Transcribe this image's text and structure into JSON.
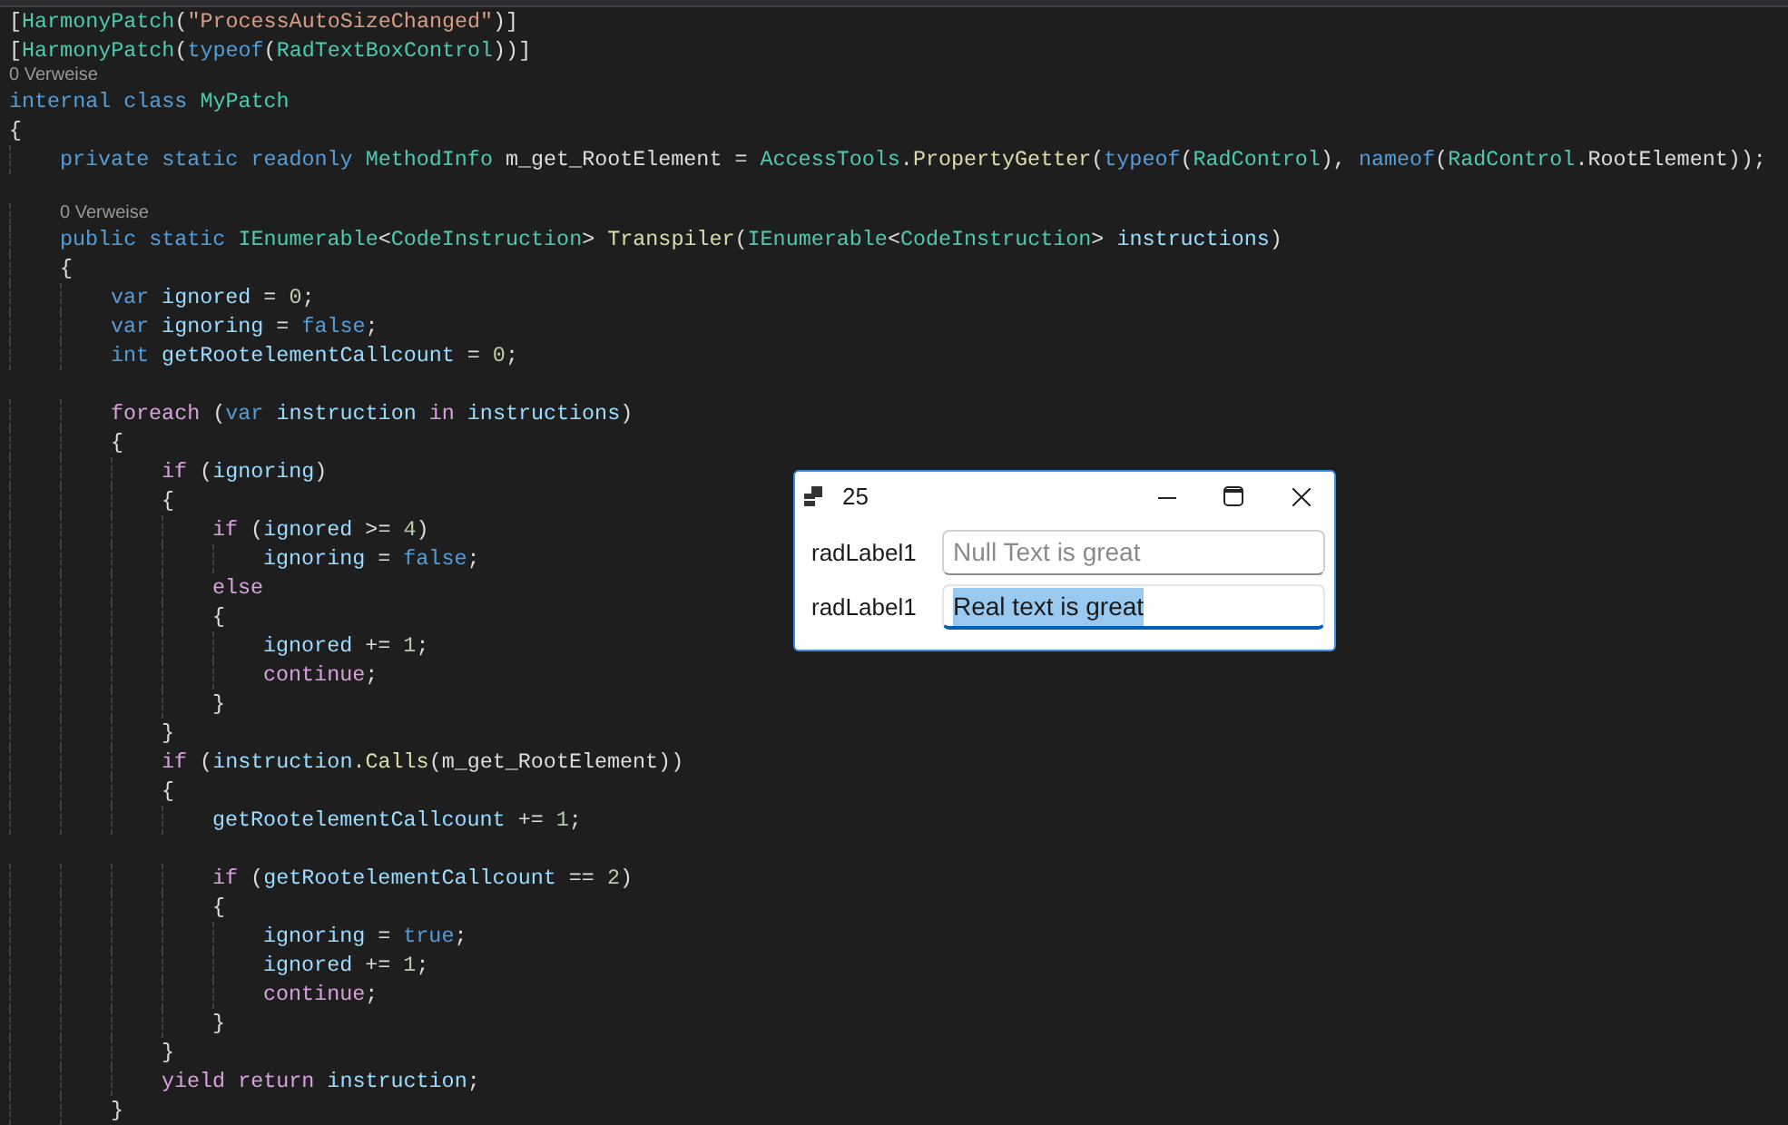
{
  "code_lines": [
    {
      "kind": "code",
      "tokens": [
        {
          "kind": "plain",
          "text": "["
        },
        {
          "kind": "type",
          "text": "HarmonyPatch"
        },
        {
          "kind": "plain",
          "text": "("
        },
        {
          "kind": "string",
          "text": "\"ProcessAutoSizeChanged\""
        },
        {
          "kind": "plain",
          "text": ")]"
        }
      ]
    },
    {
      "kind": "code",
      "tokens": [
        {
          "kind": "plain",
          "text": "["
        },
        {
          "kind": "type",
          "text": "HarmonyPatch"
        },
        {
          "kind": "plain",
          "text": "("
        },
        {
          "kind": "keyword",
          "text": "typeof"
        },
        {
          "kind": "plain",
          "text": "("
        },
        {
          "kind": "type",
          "text": "RadTextBoxControl"
        },
        {
          "kind": "plain",
          "text": "))]"
        }
      ]
    },
    {
      "kind": "lens",
      "text": "0 Verweise"
    },
    {
      "kind": "code",
      "tokens": [
        {
          "kind": "keyword",
          "text": "internal class "
        },
        {
          "kind": "type",
          "text": "MyPatch"
        }
      ]
    },
    {
      "kind": "code",
      "tokens": [
        {
          "kind": "plain",
          "text": "{"
        }
      ]
    },
    {
      "kind": "code",
      "tokens": [
        {
          "kind": "keyword",
          "text": "    private static readonly "
        },
        {
          "kind": "type",
          "text": "MethodInfo"
        },
        {
          "kind": "plain",
          "text": " m_get_RootElement = "
        },
        {
          "kind": "type",
          "text": "AccessTools"
        },
        {
          "kind": "plain",
          "text": "."
        },
        {
          "kind": "method",
          "text": "PropertyGetter"
        },
        {
          "kind": "plain",
          "text": "("
        },
        {
          "kind": "keyword",
          "text": "typeof"
        },
        {
          "kind": "plain",
          "text": "("
        },
        {
          "kind": "type",
          "text": "RadControl"
        },
        {
          "kind": "plain",
          "text": "), "
        },
        {
          "kind": "keyword",
          "text": "nameof"
        },
        {
          "kind": "plain",
          "text": "("
        },
        {
          "kind": "type",
          "text": "RadControl"
        },
        {
          "kind": "plain",
          "text": ".RootElement));"
        }
      ]
    },
    {
      "kind": "blank"
    },
    {
      "kind": "lens",
      "text": "    0 Verweise"
    },
    {
      "kind": "code",
      "tokens": [
        {
          "kind": "keyword",
          "text": "    public static "
        },
        {
          "kind": "type",
          "text": "IEnumerable"
        },
        {
          "kind": "plain",
          "text": "<"
        },
        {
          "kind": "type",
          "text": "CodeInstruction"
        },
        {
          "kind": "plain",
          "text": "> "
        },
        {
          "kind": "method",
          "text": "Transpiler"
        },
        {
          "kind": "plain",
          "text": "("
        },
        {
          "kind": "type",
          "text": "IEnumerable"
        },
        {
          "kind": "plain",
          "text": "<"
        },
        {
          "kind": "type",
          "text": "CodeInstruction"
        },
        {
          "kind": "plain",
          "text": "> "
        },
        {
          "kind": "ident",
          "text": "instructions"
        },
        {
          "kind": "plain",
          "text": ")"
        }
      ]
    },
    {
      "kind": "code",
      "tokens": [
        {
          "kind": "plain",
          "text": "    {"
        }
      ]
    },
    {
      "kind": "code",
      "tokens": [
        {
          "kind": "keyword",
          "text": "        var"
        },
        {
          "kind": "ident",
          "text": " ignored"
        },
        {
          "kind": "plain",
          "text": " = "
        },
        {
          "kind": "number",
          "text": "0"
        },
        {
          "kind": "plain",
          "text": ";"
        }
      ]
    },
    {
      "kind": "code",
      "tokens": [
        {
          "kind": "keyword",
          "text": "        var"
        },
        {
          "kind": "ident",
          "text": " ignoring"
        },
        {
          "kind": "plain",
          "text": " = "
        },
        {
          "kind": "keyword",
          "text": "false"
        },
        {
          "kind": "plain",
          "text": ";"
        }
      ]
    },
    {
      "kind": "code",
      "tokens": [
        {
          "kind": "keyword",
          "text": "        int"
        },
        {
          "kind": "ident",
          "text": " getRootelementCallcount"
        },
        {
          "kind": "plain",
          "text": " = "
        },
        {
          "kind": "number",
          "text": "0"
        },
        {
          "kind": "plain",
          "text": ";"
        }
      ]
    },
    {
      "kind": "blank"
    },
    {
      "kind": "code",
      "tokens": [
        {
          "kind": "control",
          "text": "        foreach"
        },
        {
          "kind": "plain",
          "text": " ("
        },
        {
          "kind": "keyword",
          "text": "var"
        },
        {
          "kind": "ident",
          "text": " instruction"
        },
        {
          "kind": "control",
          "text": " in"
        },
        {
          "kind": "ident",
          "text": " instructions"
        },
        {
          "kind": "plain",
          "text": ")"
        }
      ]
    },
    {
      "kind": "code",
      "tokens": [
        {
          "kind": "plain",
          "text": "        {"
        }
      ]
    },
    {
      "kind": "code",
      "tokens": [
        {
          "kind": "control",
          "text": "            if"
        },
        {
          "kind": "plain",
          "text": " ("
        },
        {
          "kind": "ident",
          "text": "ignoring"
        },
        {
          "kind": "plain",
          "text": ")"
        }
      ]
    },
    {
      "kind": "code",
      "tokens": [
        {
          "kind": "plain",
          "text": "            {"
        }
      ]
    },
    {
      "kind": "code",
      "tokens": [
        {
          "kind": "control",
          "text": "                if"
        },
        {
          "kind": "plain",
          "text": " ("
        },
        {
          "kind": "ident",
          "text": "ignored"
        },
        {
          "kind": "plain",
          "text": " >= "
        },
        {
          "kind": "number",
          "text": "4"
        },
        {
          "kind": "plain",
          "text": ")"
        }
      ]
    },
    {
      "kind": "code",
      "tokens": [
        {
          "kind": "ident",
          "text": "                    ignoring"
        },
        {
          "kind": "plain",
          "text": " = "
        },
        {
          "kind": "keyword",
          "text": "false"
        },
        {
          "kind": "plain",
          "text": ";"
        }
      ]
    },
    {
      "kind": "code",
      "tokens": [
        {
          "kind": "control",
          "text": "                else"
        }
      ]
    },
    {
      "kind": "code",
      "tokens": [
        {
          "kind": "plain",
          "text": "                {"
        }
      ]
    },
    {
      "kind": "code",
      "tokens": [
        {
          "kind": "ident",
          "text": "                    ignored"
        },
        {
          "kind": "plain",
          "text": " += "
        },
        {
          "kind": "number",
          "text": "1"
        },
        {
          "kind": "plain",
          "text": ";"
        }
      ]
    },
    {
      "kind": "code",
      "tokens": [
        {
          "kind": "control",
          "text": "                    continue"
        },
        {
          "kind": "plain",
          "text": ";"
        }
      ]
    },
    {
      "kind": "code",
      "tokens": [
        {
          "kind": "plain",
          "text": "                }"
        }
      ]
    },
    {
      "kind": "code",
      "tokens": [
        {
          "kind": "plain",
          "text": "            }"
        }
      ]
    },
    {
      "kind": "code",
      "tokens": [
        {
          "kind": "control",
          "text": "            if"
        },
        {
          "kind": "plain",
          "text": " ("
        },
        {
          "kind": "ident",
          "text": "instruction"
        },
        {
          "kind": "plain",
          "text": "."
        },
        {
          "kind": "method",
          "text": "Calls"
        },
        {
          "kind": "plain",
          "text": "(m_get_RootElement))"
        }
      ]
    },
    {
      "kind": "code",
      "tokens": [
        {
          "kind": "plain",
          "text": "            {"
        }
      ]
    },
    {
      "kind": "code",
      "tokens": [
        {
          "kind": "ident",
          "text": "                getRootelementCallcount"
        },
        {
          "kind": "plain",
          "text": " += "
        },
        {
          "kind": "number",
          "text": "1"
        },
        {
          "kind": "plain",
          "text": ";"
        }
      ]
    },
    {
      "kind": "blank"
    },
    {
      "kind": "code",
      "tokens": [
        {
          "kind": "control",
          "text": "                if"
        },
        {
          "kind": "plain",
          "text": " ("
        },
        {
          "kind": "ident",
          "text": "getRootelementCallcount"
        },
        {
          "kind": "plain",
          "text": " == "
        },
        {
          "kind": "number",
          "text": "2"
        },
        {
          "kind": "plain",
          "text": ")"
        }
      ]
    },
    {
      "kind": "code",
      "tokens": [
        {
          "kind": "plain",
          "text": "                {"
        }
      ]
    },
    {
      "kind": "code",
      "tokens": [
        {
          "kind": "ident",
          "text": "                    ignoring"
        },
        {
          "kind": "plain",
          "text": " = "
        },
        {
          "kind": "keyword",
          "text": "true"
        },
        {
          "kind": "plain",
          "text": ";"
        }
      ]
    },
    {
      "kind": "code",
      "tokens": [
        {
          "kind": "ident",
          "text": "                    ignored"
        },
        {
          "kind": "plain",
          "text": " += "
        },
        {
          "kind": "number",
          "text": "1"
        },
        {
          "kind": "plain",
          "text": ";"
        }
      ]
    },
    {
      "kind": "code",
      "tokens": [
        {
          "kind": "control",
          "text": "                    continue"
        },
        {
          "kind": "plain",
          "text": ";"
        }
      ]
    },
    {
      "kind": "code",
      "tokens": [
        {
          "kind": "plain",
          "text": "                }"
        }
      ]
    },
    {
      "kind": "code",
      "tokens": [
        {
          "kind": "plain",
          "text": "            }"
        }
      ]
    },
    {
      "kind": "code",
      "tokens": [
        {
          "kind": "control",
          "text": "            yield return"
        },
        {
          "kind": "ident",
          "text": " instruction"
        },
        {
          "kind": "plain",
          "text": ";"
        }
      ]
    },
    {
      "kind": "code",
      "tokens": [
        {
          "kind": "plain",
          "text": "        }"
        }
      ]
    }
  ],
  "dialog": {
    "title": "25",
    "rows": [
      {
        "label": "radLabel1",
        "placeholder": "Null Text is great",
        "focused": false
      },
      {
        "label": "radLabel1",
        "value": "Real text is great",
        "focused": true,
        "text_selected": true
      }
    ]
  }
}
